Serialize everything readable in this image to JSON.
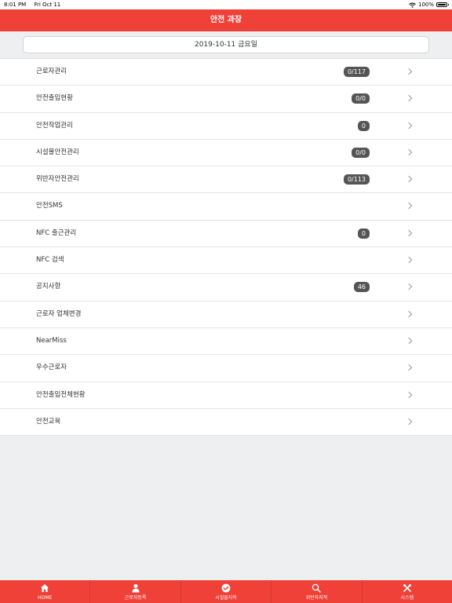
{
  "status_bar": {
    "time": "8:01 PM",
    "date": "Fri Oct 11",
    "battery": "100%"
  },
  "header": {
    "title": "안전 과장"
  },
  "date_display": "2019-10-11 금요일",
  "menu": [
    {
      "label": "근로자관리",
      "badge": "0/117"
    },
    {
      "label": "안전출입현황",
      "badge": "0/0"
    },
    {
      "label": "안전작업관리",
      "badge": "0"
    },
    {
      "label": "시설물안전관리",
      "badge": "0/0"
    },
    {
      "label": "위반자안전관리",
      "badge": "0/113"
    },
    {
      "label": "안전SMS",
      "badge": ""
    },
    {
      "label": "NFC 출근관리",
      "badge": "0"
    },
    {
      "label": "NFC 검색",
      "badge": ""
    },
    {
      "label": "공지사항",
      "badge": "46"
    },
    {
      "label": "근로자 업체변경",
      "badge": ""
    },
    {
      "label": "NearMiss",
      "badge": ""
    },
    {
      "label": "우수근로자",
      "badge": ""
    },
    {
      "label": "안전출입전체현황",
      "badge": ""
    },
    {
      "label": "안전교육",
      "badge": ""
    }
  ],
  "tabs": [
    {
      "label": "HOME",
      "icon": "home-icon"
    },
    {
      "label": "근로자등록",
      "icon": "person-icon"
    },
    {
      "label": "시설물지적",
      "icon": "check-circle-icon"
    },
    {
      "label": "위반자지적",
      "icon": "search-icon"
    },
    {
      "label": "시스템",
      "icon": "tools-icon"
    }
  ],
  "colors": {
    "accent": "#ef4138",
    "badge": "#555555"
  }
}
